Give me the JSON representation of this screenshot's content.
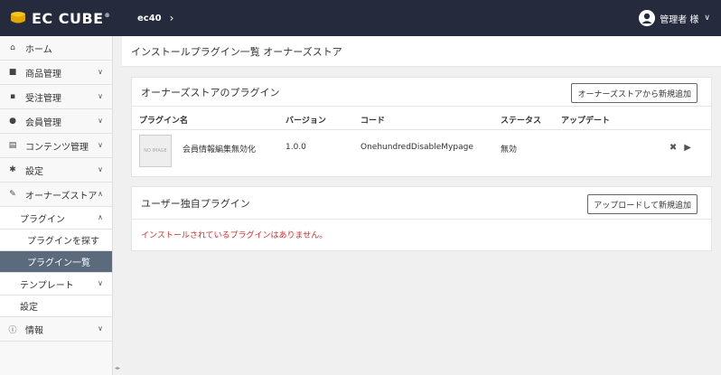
{
  "header": {
    "logo_text": "EC CUBE",
    "logo_tm": "®",
    "shop_name": "ec40",
    "user_name": "管理者 様",
    "brand_color": "#252a3c"
  },
  "sidebar": {
    "items": [
      {
        "label": "ホーム",
        "icon": "home-icon"
      },
      {
        "label": "商品管理",
        "icon": "cube-icon"
      },
      {
        "label": "受注管理",
        "icon": "cart-icon"
      },
      {
        "label": "会員管理",
        "icon": "users-icon"
      },
      {
        "label": "コンテンツ管理",
        "icon": "file-icon"
      },
      {
        "label": "設定",
        "icon": "gear-icon"
      },
      {
        "label": "オーナーズストア",
        "icon": "wrench-icon"
      }
    ],
    "owners_sub": {
      "plugin": "プラグイン",
      "plugin_search": "プラグインを探す",
      "plugin_list": "プラグイン一覧",
      "template": "テンプレート",
      "setting": "設定"
    },
    "info": {
      "label": "情報",
      "icon": "info-icon"
    }
  },
  "page": {
    "title": "インストールプラグイン一覧 オーナーズストア"
  },
  "store_card": {
    "title": "オーナーズストアのプラグイン",
    "button": "オーナーズストアから新規追加",
    "columns": [
      "プラグイン名",
      "バージョン",
      "コード",
      "ステータス",
      "アップデート"
    ],
    "rows": [
      {
        "thumb_text": "NO IMAGE",
        "name": "会員情報編集無効化",
        "version": "1.0.0",
        "code": "OnehundredDisableMypage",
        "status": "無効"
      }
    ]
  },
  "user_card": {
    "title": "ユーザー独自プラグイン",
    "button": "アップロードして新規追加",
    "empty": "インストールされているプラグインはありません。"
  }
}
